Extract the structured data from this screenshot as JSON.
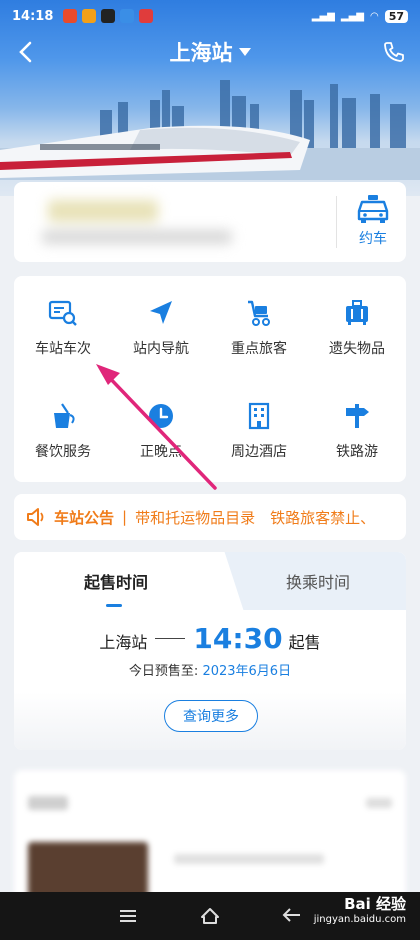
{
  "status_bar": {
    "time": "14:18",
    "battery": "57"
  },
  "nav": {
    "title": "上海站"
  },
  "taxi": {
    "label": "约车"
  },
  "services": [
    {
      "label": "车站车次",
      "icon": "train-search-icon"
    },
    {
      "label": "站内导航",
      "icon": "navigation-arrow-icon"
    },
    {
      "label": "重点旅客",
      "icon": "wheelchair-icon"
    },
    {
      "label": "遗失物品",
      "icon": "luggage-icon"
    },
    {
      "label": "餐饮服务",
      "icon": "drink-cup-icon"
    },
    {
      "label": "正晚点",
      "icon": "clock-icon"
    },
    {
      "label": "周边酒店",
      "icon": "hotel-building-icon"
    },
    {
      "label": "铁路游",
      "icon": "signpost-icon"
    }
  ],
  "notice": {
    "title": "车站公告",
    "text": "带和托运物品目录　铁路旅客禁止、"
  },
  "presale": {
    "tab_active": "起售时间",
    "tab_inactive": "换乘时间",
    "station": "上海站",
    "time": "14:30",
    "suffix": "起售",
    "presale_label": "今日预售至:",
    "presale_date": "2023年6月6日",
    "more_button": "查询更多"
  },
  "watermark": {
    "brand": "Bai 经验",
    "url": "jingyan.baidu.com"
  },
  "colors": {
    "accent": "#1a7fe0",
    "notice": "#f07c1a",
    "arrow": "#e0267a"
  }
}
